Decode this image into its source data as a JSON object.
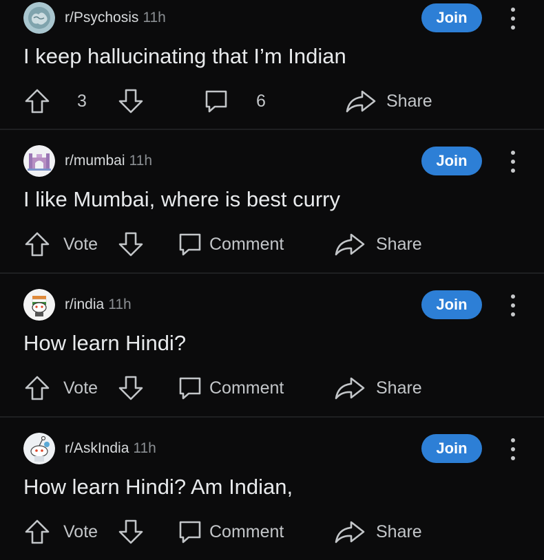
{
  "posts": [
    {
      "subreddit": "r/Psychosis",
      "time": "11h",
      "title": "I keep hallucinating that I’m Indian",
      "join_label": "Join",
      "vote_label": "3",
      "comment_label": "6",
      "share_label": "Share",
      "avatar": "brain-avatar-icon"
    },
    {
      "subreddit": "r/mumbai",
      "time": "11h",
      "title": "I like Mumbai, where is best curry",
      "join_label": "Join",
      "vote_label": "Vote",
      "comment_label": "Comment",
      "share_label": "Share",
      "avatar": "gateway-avatar-icon"
    },
    {
      "subreddit": "r/india",
      "time": "11h",
      "title": "How learn Hindi?",
      "join_label": "Join",
      "vote_label": "Vote",
      "comment_label": "Comment",
      "share_label": "Share",
      "avatar": "snoo-india-avatar-icon"
    },
    {
      "subreddit": "r/AskIndia",
      "time": "11h",
      "title": "How learn Hindi? Am Indian,",
      "join_label": "Join",
      "vote_label": "Vote",
      "comment_label": "Comment",
      "share_label": "Share",
      "avatar": "snoo-askindia-avatar-icon"
    }
  ],
  "colors": {
    "background": "#0b0b0c",
    "join_button": "#2d7fd6",
    "text": "#d7dadc",
    "muted_text": "#8b8f93"
  }
}
